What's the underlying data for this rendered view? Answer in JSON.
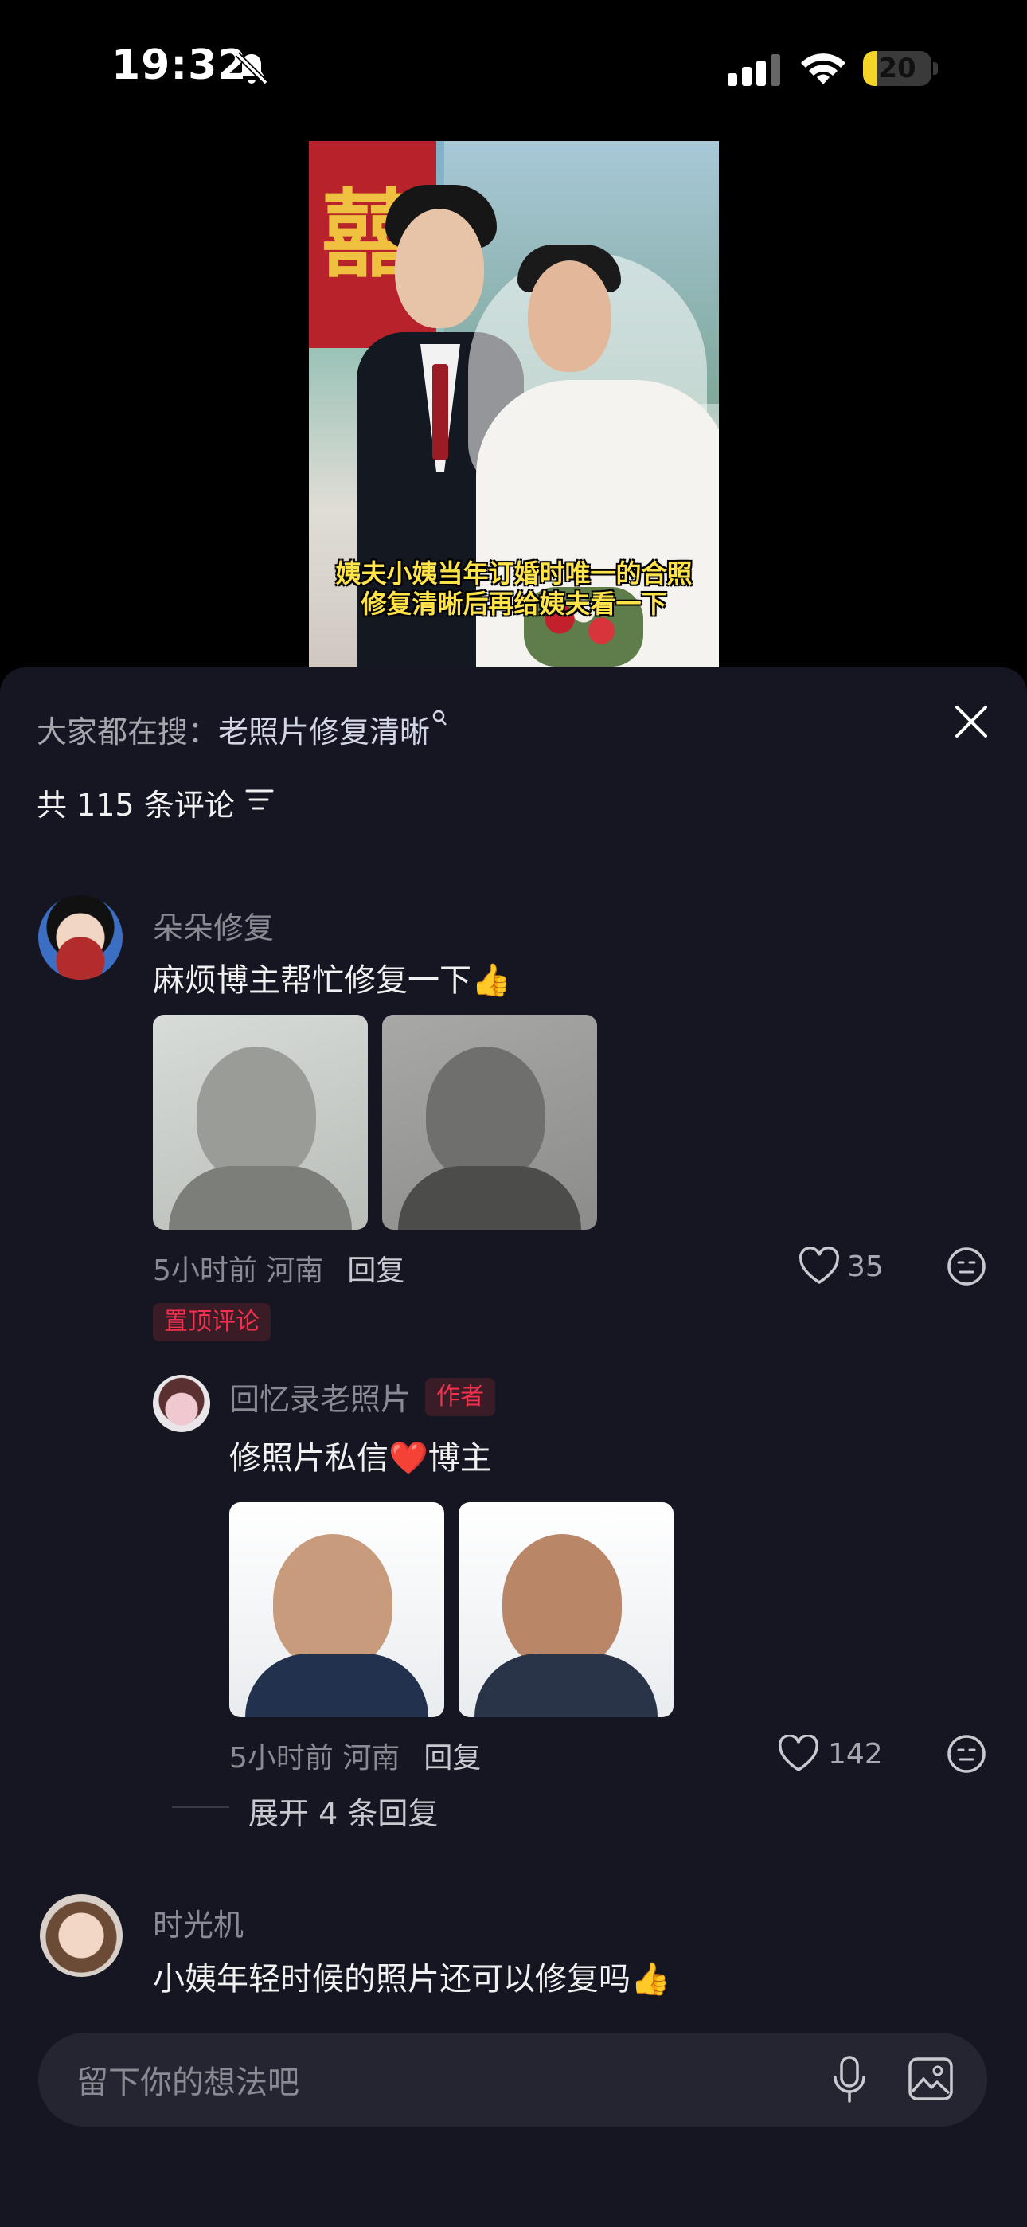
{
  "status": {
    "time": "19:32",
    "battery": "20",
    "battery_level": 0.2
  },
  "video": {
    "caption_line1": "姨夫小姨当年订婚时唯一的合照",
    "caption_line2": "修复清晰后再给姨夫看一下",
    "decor_text": "囍"
  },
  "search": {
    "prefix": "大家都在搜：",
    "query": "老照片修复清晰"
  },
  "comments_header": {
    "count_text": "共 115 条评论"
  },
  "comments": [
    {
      "username": "朵朵修复",
      "text": "麻烦博主帮忙修复一下👍",
      "time_location": "5小时前 河南",
      "reply_label": "回复",
      "likes": "35",
      "pin_badge": "置顶评论"
    },
    {
      "username": "回忆录老照片",
      "author_badge": "作者",
      "text": "修照片私信❤️博主",
      "time_location": "5小时前 河南",
      "reply_label": "回复",
      "likes": "142"
    },
    {
      "username": "时光机",
      "text": "小姨年轻时候的照片还可以修复吗👍"
    }
  ],
  "expand_replies": "展开 4 条回复",
  "input": {
    "placeholder": "留下你的想法吧"
  },
  "colors": {
    "accent_red": "#f2314f",
    "sheet_bg": "#161622",
    "caption_yellow": "#ffe34a"
  }
}
